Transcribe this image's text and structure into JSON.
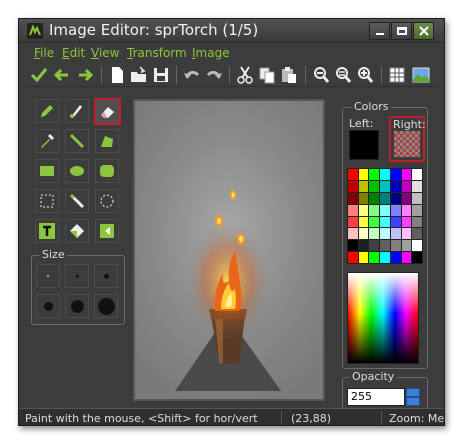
{
  "window": {
    "title": "Image Editor: sprTorch (1/5)"
  },
  "menu": [
    {
      "label": "File",
      "accel": "F"
    },
    {
      "label": "Edit",
      "accel": "E"
    },
    {
      "label": "View",
      "accel": "V"
    },
    {
      "label": "Transform",
      "accel": "T"
    },
    {
      "label": "Image",
      "accel": "I"
    }
  ],
  "toolbar": {
    "icons": [
      "confirm-check-icon",
      "previous-frame-arrow-icon",
      "next-frame-arrow-icon",
      "new-image-icon",
      "open-image-icon",
      "save-image-icon",
      "undo-icon",
      "redo-icon",
      "cut-icon",
      "copy-icon",
      "paste-icon",
      "zoom-out-icon",
      "zoom-in-icon",
      "zoom-reset-icon",
      "grid-toggle-icon",
      "image-preview-icon"
    ]
  },
  "tools": {
    "selected": "eraser",
    "items": [
      "pencil",
      "spray-pen",
      "eraser",
      "color-picker",
      "line",
      "polygon",
      "rectangle",
      "ellipse",
      "rounded-rectangle",
      "select-rectangle",
      "magic-wand",
      "select-ellipse",
      "text",
      "fill",
      "change-color"
    ]
  },
  "size": {
    "label": "Size",
    "selected": 1,
    "options": [
      "1",
      "2",
      "3",
      "4",
      "5",
      "6"
    ]
  },
  "colors": {
    "title": "Colors",
    "left_label": "Left:",
    "right_label": "Right:",
    "left_color": "#000000",
    "right_color": "transparent",
    "palette": [
      "#ff0000",
      "#ffff00",
      "#00ff00",
      "#00ffff",
      "#0000ff",
      "#ff00ff",
      "#ffffff",
      "#c00000",
      "#c0c000",
      "#00c000",
      "#00c0c0",
      "#0000c0",
      "#c000c0",
      "#e0e0e0",
      "#800000",
      "#808000",
      "#008000",
      "#008080",
      "#000080",
      "#800080",
      "#c0c0c0",
      "#ff8080",
      "#ffff80",
      "#80ff80",
      "#80ffff",
      "#8080ff",
      "#ff80ff",
      "#a0a0a0",
      "#ff4040",
      "#ffff40",
      "#40ff40",
      "#40ffff",
      "#4040ff",
      "#ff40ff",
      "#808080",
      "#ffc0c0",
      "#ffffc0",
      "#c0ffc0",
      "#c0ffff",
      "#c0c0ff",
      "#ffc0ff",
      "#606060",
      "#000000",
      "#202020",
      "#404040",
      "#606060",
      "#808080",
      "#a0a0a0",
      "#ffffff",
      "#ff0000",
      "#ffff00",
      "#00ff00",
      "#00ffff",
      "#0000ff",
      "#ff00ff",
      "#000000"
    ]
  },
  "opacity": {
    "title": "Opacity",
    "value": "255"
  },
  "status": {
    "hint": "Paint with the mouse, <Shift> for hor/vert",
    "coords": "(23,88)",
    "zoom": "Zoom: Me"
  },
  "theme": {
    "accent": "#8cc63f",
    "selection": "#c0202a",
    "background": "#3c3c3c"
  }
}
